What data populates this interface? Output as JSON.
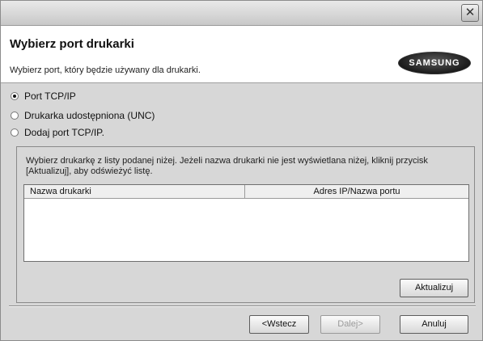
{
  "window": {
    "close_glyph": "✕"
  },
  "header": {
    "title": "Wybierz port drukarki",
    "subtitle": "Wybierz port, który będzie używany dla drukarki.",
    "logo_text": "SAMSUNG"
  },
  "options": [
    {
      "label": "Port TCP/IP",
      "selected": true
    },
    {
      "label": "Drukarka udostępniona (UNC)",
      "selected": false
    },
    {
      "label": "Dodaj port TCP/IP.",
      "selected": false
    }
  ],
  "panel": {
    "instruction": "Wybierz drukarkę z listy podanej niżej. Jeżeli nazwa drukarki nie jest wyświetlana niżej, kliknij przycisk [Aktualizuj], aby odświeżyć listę.",
    "columns": [
      "Nazwa drukarki",
      "Adres IP/Nazwa portu"
    ],
    "rows": [],
    "refresh_label": "Aktualizuj"
  },
  "footer": {
    "back_label": "<Wstecz",
    "next_label": "Dalej>",
    "cancel_label": "Anuluj"
  }
}
